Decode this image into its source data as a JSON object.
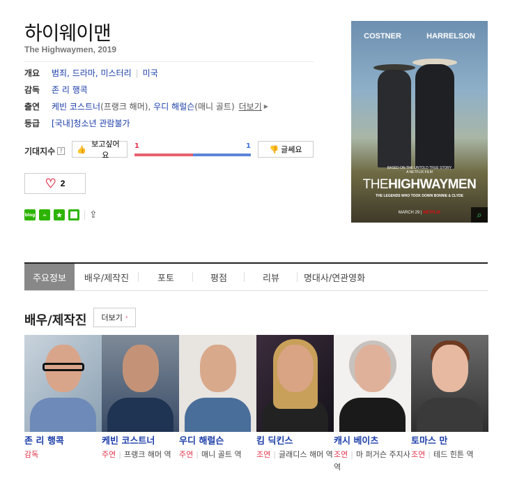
{
  "movie": {
    "title": "하이웨이맨",
    "subtitle": "The Highwaymen, 2019"
  },
  "info": {
    "overview_label": "개요",
    "genres": "범죄, 드라마, 미스터리",
    "country": "미국",
    "director_label": "감독",
    "director": "존 리 행콕",
    "cast_label": "출연",
    "cast_1": "케빈 코스트너",
    "cast_1_role": "(프랭크 해머),",
    "cast_2": "우디 해럴슨",
    "cast_2_role": "(매니 골트)",
    "more": "더보기",
    "rating_label": "등급",
    "rating": "[국내]청소년 관람불가"
  },
  "expectation": {
    "label": "기대지수",
    "help": "?",
    "want_label": "보고싶어요",
    "nah_label": "글쎄요",
    "want_count": "1",
    "nah_count": "1",
    "want_ratio": 0.5
  },
  "like": {
    "count": "2"
  },
  "share_icons": [
    "blog-icon",
    "cafe-icon",
    "bookmark-star-icon",
    "memo-icon",
    "share-icon"
  ],
  "poster": {
    "cast_left": "COSTNER",
    "cast_right": "HARRELSON",
    "tagline": "BASED ON THE UNTOLD TRUE STORY",
    "film_by": "A NETFLIX FILM",
    "title_the": "THE",
    "title_main": "HIGHWAYMEN",
    "legend": "THE LEGENDS WHO TOOK DOWN BONNIE & CLYDE",
    "date": "MARCH 29",
    "brand": "NETFLIX"
  },
  "tabs": [
    "주요정보",
    "배우/제작진",
    "포토",
    "평점",
    "리뷰",
    "명대사/연관영화"
  ],
  "cast_section": {
    "title": "배우/제작진",
    "more": "더보기",
    "people": [
      {
        "name": "존 리 행콕",
        "kind": "감독",
        "role": ""
      },
      {
        "name": "케빈 코스트너",
        "kind": "주연",
        "role": "프랭크 해머 역"
      },
      {
        "name": "우디 해럴슨",
        "kind": "주연",
        "role": "매니 골트 역"
      },
      {
        "name": "킴 딕킨스",
        "kind": "조연",
        "role": "글래디스 해머 역"
      },
      {
        "name": "캐시 베이츠",
        "kind": "조연",
        "role": "마 퍼거슨 주지사 역"
      },
      {
        "name": "토마스 만",
        "kind": "조연",
        "role": "테드 힌튼 역"
      }
    ]
  }
}
